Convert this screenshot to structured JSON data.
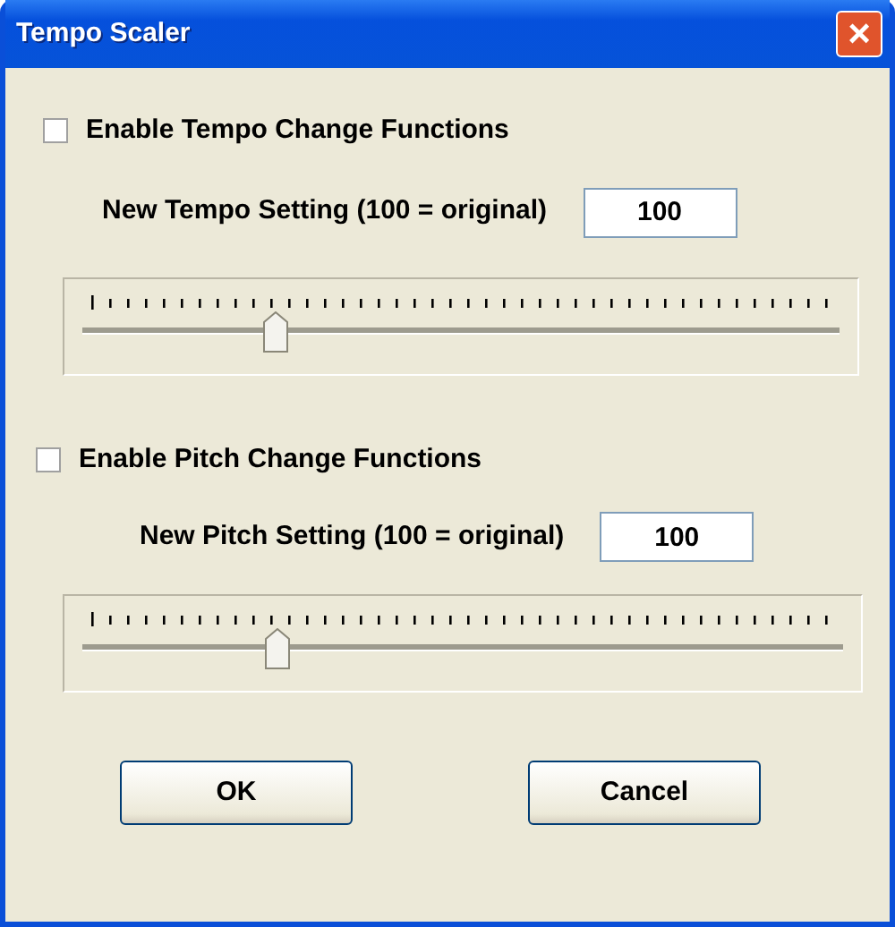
{
  "window": {
    "title": "Tempo Scaler",
    "close": "×"
  },
  "sections": [
    {
      "checkbox": {
        "label": "Enable Tempo Change Functions",
        "checked": false
      },
      "setting": {
        "label": "New Tempo Setting (100 = original)",
        "value": "100"
      },
      "slider": {
        "level": 0.25
      }
    },
    {
      "checkbox": {
        "label": "Enable Pitch Change Functions",
        "checked": false
      },
      "setting": {
        "label": "New Pitch Setting (100 = original)",
        "value": "100"
      },
      "slider": {
        "level": 0.25
      }
    }
  ],
  "buttons": [
    "OK",
    "Cancel"
  ]
}
